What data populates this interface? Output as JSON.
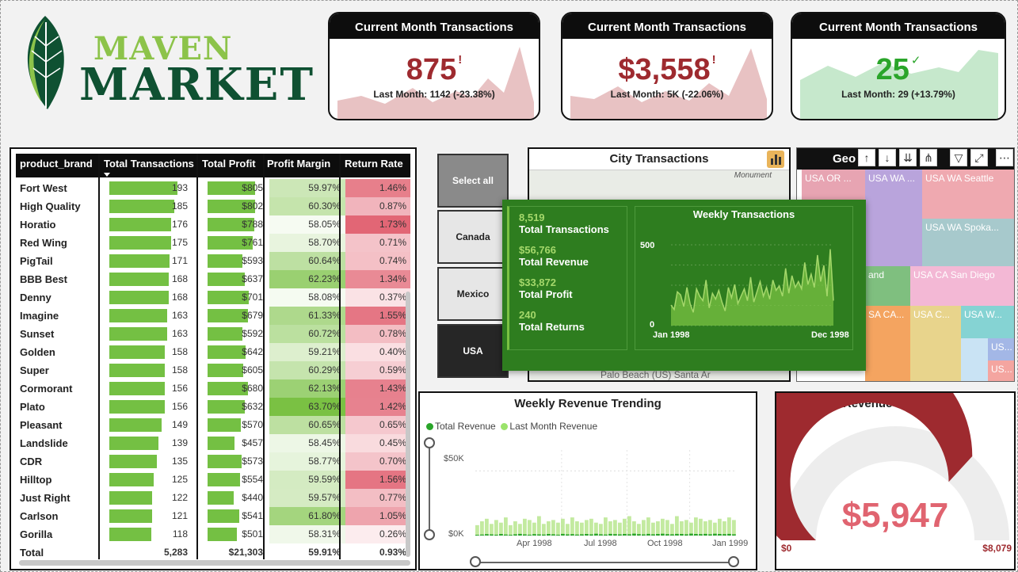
{
  "logo": {
    "line1": "MAVEN",
    "line2": "MARKET"
  },
  "kpis": [
    {
      "title": "Current Month Transactions",
      "value": "875",
      "flag": "!",
      "subtitle": "Last Month: 1142 (-23.38%)",
      "status": "down",
      "color": "#9e2a2f"
    },
    {
      "title": "Current Month Transactions",
      "value": "$3,558",
      "flag": "!",
      "subtitle": "Last Month: 5K (-22.06%)",
      "status": "down",
      "color": "#9e2a2f"
    },
    {
      "title": "Current Month Transactions",
      "value": "25",
      "flag": "✓",
      "subtitle": "Last Month: 29 (+13.79%)",
      "status": "up",
      "color": "#2aa52a"
    }
  ],
  "table": {
    "headers": [
      "product_brand",
      "Total Transactions",
      "Total Profit",
      "Profit Margin",
      "Return Rate"
    ],
    "sorted_column": "Total Transactions",
    "rows": [
      {
        "brand": "Fort West",
        "tx": "193",
        "profit": "$805",
        "margin": "59.97%",
        "ret": "1.46%",
        "txn": 193,
        "pn": 805,
        "mn": 59.97,
        "rn": 1.46
      },
      {
        "brand": "High Quality",
        "tx": "185",
        "profit": "$802",
        "margin": "60.30%",
        "ret": "0.87%",
        "txn": 185,
        "pn": 802,
        "mn": 60.3,
        "rn": 0.87
      },
      {
        "brand": "Horatio",
        "tx": "176",
        "profit": "$788",
        "margin": "58.05%",
        "ret": "1.73%",
        "txn": 176,
        "pn": 788,
        "mn": 58.05,
        "rn": 1.73
      },
      {
        "brand": "Red Wing",
        "tx": "175",
        "profit": "$761",
        "margin": "58.70%",
        "ret": "0.71%",
        "txn": 175,
        "pn": 761,
        "mn": 58.7,
        "rn": 0.71
      },
      {
        "brand": "PigTail",
        "tx": "171",
        "profit": "$593",
        "margin": "60.64%",
        "ret": "0.74%",
        "txn": 171,
        "pn": 593,
        "mn": 60.64,
        "rn": 0.74
      },
      {
        "brand": "BBB Best",
        "tx": "168",
        "profit": "$637",
        "margin": "62.23%",
        "ret": "1.34%",
        "txn": 168,
        "pn": 637,
        "mn": 62.23,
        "rn": 1.34
      },
      {
        "brand": "Denny",
        "tx": "168",
        "profit": "$701",
        "margin": "58.08%",
        "ret": "0.37%",
        "txn": 168,
        "pn": 701,
        "mn": 58.08,
        "rn": 0.37
      },
      {
        "brand": "Imagine",
        "tx": "163",
        "profit": "$679",
        "margin": "61.33%",
        "ret": "1.55%",
        "txn": 163,
        "pn": 679,
        "mn": 61.33,
        "rn": 1.55
      },
      {
        "brand": "Sunset",
        "tx": "163",
        "profit": "$592",
        "margin": "60.72%",
        "ret": "0.78%",
        "txn": 163,
        "pn": 592,
        "mn": 60.72,
        "rn": 0.78
      },
      {
        "brand": "Golden",
        "tx": "158",
        "profit": "$642",
        "margin": "59.21%",
        "ret": "0.40%",
        "txn": 158,
        "pn": 642,
        "mn": 59.21,
        "rn": 0.4
      },
      {
        "brand": "Super",
        "tx": "158",
        "profit": "$605",
        "margin": "60.29%",
        "ret": "0.59%",
        "txn": 158,
        "pn": 605,
        "mn": 60.29,
        "rn": 0.59
      },
      {
        "brand": "Cormorant",
        "tx": "156",
        "profit": "$680",
        "margin": "62.13%",
        "ret": "1.43%",
        "txn": 156,
        "pn": 680,
        "mn": 62.13,
        "rn": 1.43
      },
      {
        "brand": "Plato",
        "tx": "156",
        "profit": "$632",
        "margin": "63.70%",
        "ret": "1.42%",
        "txn": 156,
        "pn": 632,
        "mn": 63.7,
        "rn": 1.42
      },
      {
        "brand": "Pleasant",
        "tx": "149",
        "profit": "$570",
        "margin": "60.65%",
        "ret": "0.65%",
        "txn": 149,
        "pn": 570,
        "mn": 60.65,
        "rn": 0.65
      },
      {
        "brand": "Landslide",
        "tx": "139",
        "profit": "$457",
        "margin": "58.45%",
        "ret": "0.45%",
        "txn": 139,
        "pn": 457,
        "mn": 58.45,
        "rn": 0.45
      },
      {
        "brand": "CDR",
        "tx": "135",
        "profit": "$573",
        "margin": "58.77%",
        "ret": "0.70%",
        "txn": 135,
        "pn": 573,
        "mn": 58.77,
        "rn": 0.7
      },
      {
        "brand": "Hilltop",
        "tx": "125",
        "profit": "$554",
        "margin": "59.59%",
        "ret": "1.56%",
        "txn": 125,
        "pn": 554,
        "mn": 59.59,
        "rn": 1.56
      },
      {
        "brand": "Just Right",
        "tx": "122",
        "profit": "$440",
        "margin": "59.57%",
        "ret": "0.77%",
        "txn": 122,
        "pn": 440,
        "mn": 59.57,
        "rn": 0.77
      },
      {
        "brand": "Carlson",
        "tx": "121",
        "profit": "$541",
        "margin": "61.80%",
        "ret": "1.05%",
        "txn": 121,
        "pn": 541,
        "mn": 61.8,
        "rn": 1.05
      },
      {
        "brand": "Gorilla",
        "tx": "118",
        "profit": "$501",
        "margin": "58.31%",
        "ret": "0.26%",
        "txn": 118,
        "pn": 501,
        "mn": 58.31,
        "rn": 0.26
      }
    ],
    "total": {
      "brand": "Total",
      "tx": "5,283",
      "profit": "$21,303",
      "margin": "59.91%",
      "ret": "0.93%"
    }
  },
  "slicer": {
    "options": [
      "Select all",
      "Canada",
      "Mexico",
      "USA"
    ],
    "selected": "USA"
  },
  "city_map": {
    "title": "City Transactions",
    "label": "Monument",
    "footer_text": "Palo    Beach    (US)  Santa Ar"
  },
  "treemap": {
    "title": "Geo",
    "tiles": [
      {
        "label": "USA OR ...",
        "color": "#e7a4b2"
      },
      {
        "label": "USA WA ...",
        "color": "#b9a4dc"
      },
      {
        "label": "USA WA Seattle",
        "color": "#efa9b0"
      },
      {
        "label": "USA WA Spoka...",
        "color": "#a7c9cc"
      },
      {
        "label": "and",
        "color": "#7fbf7f"
      },
      {
        "label": "USA CA San Diego",
        "color": "#f3b8d5"
      },
      {
        "label": "SA CA...",
        "color": "#f4a460"
      },
      {
        "label": "USA C...",
        "color": "#e8d48c"
      },
      {
        "label": "USA W...",
        "color": "#85d3d3"
      },
      {
        "label": "US...",
        "color": "#a3b7e6"
      },
      {
        "label": "US...",
        "color": "#f4a5a0"
      }
    ]
  },
  "tooltip": {
    "metrics": [
      {
        "value": "8,519",
        "label": "Total Transactions"
      },
      {
        "value": "$56,766",
        "label": "Total Revenue"
      },
      {
        "value": "$33,872",
        "label": "Total Profit"
      },
      {
        "value": "240",
        "label": "Total Returns"
      }
    ],
    "chart": {
      "type": "area",
      "title": "Weekly Transactions",
      "y_ticks": [
        "500",
        "0"
      ],
      "x_ticks": [
        "Jan 1998",
        "Dec 1998"
      ],
      "ylim": [
        0,
        550
      ],
      "values": [
        140,
        110,
        230,
        210,
        130,
        260,
        150,
        90,
        250,
        200,
        170,
        310,
        120,
        220,
        180,
        240,
        160,
        100,
        260,
        190,
        280,
        150,
        200,
        250,
        170,
        330,
        160,
        230,
        300,
        200,
        260,
        180,
        310,
        240,
        270,
        200,
        390,
        220,
        340,
        260,
        300,
        250,
        430,
        280,
        350,
        260,
        480,
        300,
        410,
        200,
        520,
        170
      ]
    }
  },
  "weekly_revenue": {
    "title": "Weekly Revenue Trending",
    "legend": [
      {
        "name": "Total Revenue",
        "color": "#2aa52a"
      },
      {
        "name": "Last Month Revenue",
        "color": "#9be36b"
      }
    ],
    "y_ticks": [
      "$50K",
      "$0K"
    ],
    "x_ticks": [
      "Apr 1998",
      "Jul 1998",
      "Oct 1998",
      "Jan 1999"
    ],
    "ylim": [
      0,
      60000
    ],
    "type": "bar",
    "total_revenue": [
      600,
      800,
      1100,
      900,
      700,
      1200,
      800,
      600,
      1000,
      1300,
      900,
      700,
      1100,
      900,
      800,
      1200,
      1000,
      700,
      1300,
      900,
      1100,
      800,
      1000,
      1200,
      900,
      1400,
      1000,
      800,
      1300,
      1100,
      900,
      1200,
      1000,
      1500,
      1100,
      900,
      1300,
      1000,
      1200,
      1400,
      1100,
      1000,
      1300,
      1200,
      1000,
      1500,
      1200,
      1100,
      1300,
      1000,
      1400,
      1200,
      1100,
      1300,
      1000
    ],
    "last_month_revenue": [
      8000,
      11000,
      13000,
      9000,
      12000,
      10000,
      14000,
      8000,
      11000,
      9000,
      13000,
      12000,
      10000,
      15000,
      9000,
      11000,
      12000,
      10000,
      13000,
      9000,
      14000,
      11000,
      10000,
      12000,
      13000,
      10000,
      9000,
      14000,
      11000,
      12000,
      10000,
      13000,
      15000,
      11000,
      9000,
      12000,
      14000,
      10000,
      11000,
      13000,
      12000,
      9000,
      15000,
      11000,
      12000,
      10000,
      14000,
      13000,
      11000,
      12000,
      10000,
      13000,
      11000,
      14000,
      12000
    ]
  },
  "gauge": {
    "title": "Revenue vs Target",
    "value": "$5,947",
    "min": "$0",
    "max": "$8,079",
    "value_num": 5947,
    "max_num": 8079,
    "fill_color": "#9e2a2f",
    "track_color": "#ededed"
  }
}
